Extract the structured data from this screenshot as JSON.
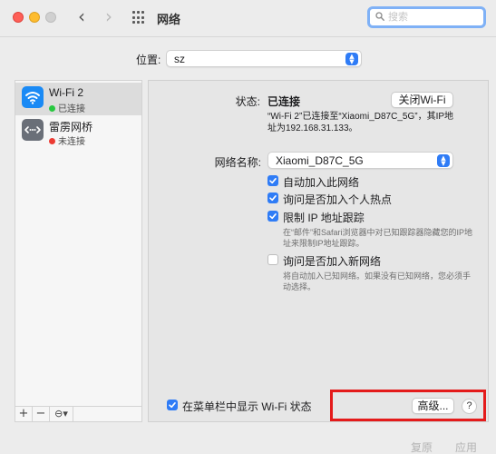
{
  "window": {
    "title": "网络",
    "search_placeholder": "搜索"
  },
  "location": {
    "label": "位置:",
    "value": "sz"
  },
  "sidebar": {
    "services": [
      {
        "name": "Wi-Fi 2",
        "status": "已连接",
        "status_color": "#28c840",
        "icon": "wifi-icon"
      },
      {
        "name": "雷雳网桥",
        "status": "未连接",
        "status_color": "#ec3b33",
        "icon": "thunderbolt-bridge-icon"
      }
    ],
    "toolbar": {
      "add": "+",
      "remove": "−",
      "action": "⊖▾"
    }
  },
  "detail": {
    "status_label": "状态:",
    "status_value": "已连接",
    "wifi_off_button": "关闭Wi-Fi",
    "status_description": "“Wi-Fi 2”已连接至“Xiaomi_D87C_5G”，其IP地址为192.168.31.133。",
    "network_name_label": "网络名称:",
    "network_name_value": "Xiaomi_D87C_5G",
    "options": [
      {
        "label": "自动加入此网络",
        "checked": true,
        "description": ""
      },
      {
        "label": "询问是否加入个人热点",
        "checked": true,
        "description": ""
      },
      {
        "label": "限制 IP 地址跟踪",
        "checked": true,
        "description": "在“邮件”和Safari浏览器中对已知跟踪器隐藏您的IP地址来限制IP地址跟踪。"
      },
      {
        "label": "询问是否加入新网络",
        "checked": false,
        "description": "将自动加入已知网络。如果没有已知网络，您必须手动选择。"
      }
    ],
    "show_in_menubar": {
      "label": "在菜单栏中显示 Wi-Fi 状态",
      "checked": true
    },
    "advanced_button": "高级...",
    "help_button": "?"
  },
  "footer": {
    "revert": "复原",
    "apply": "应用"
  },
  "colors": {
    "accent": "#2f7cf6",
    "highlight": "#e41b1b"
  }
}
